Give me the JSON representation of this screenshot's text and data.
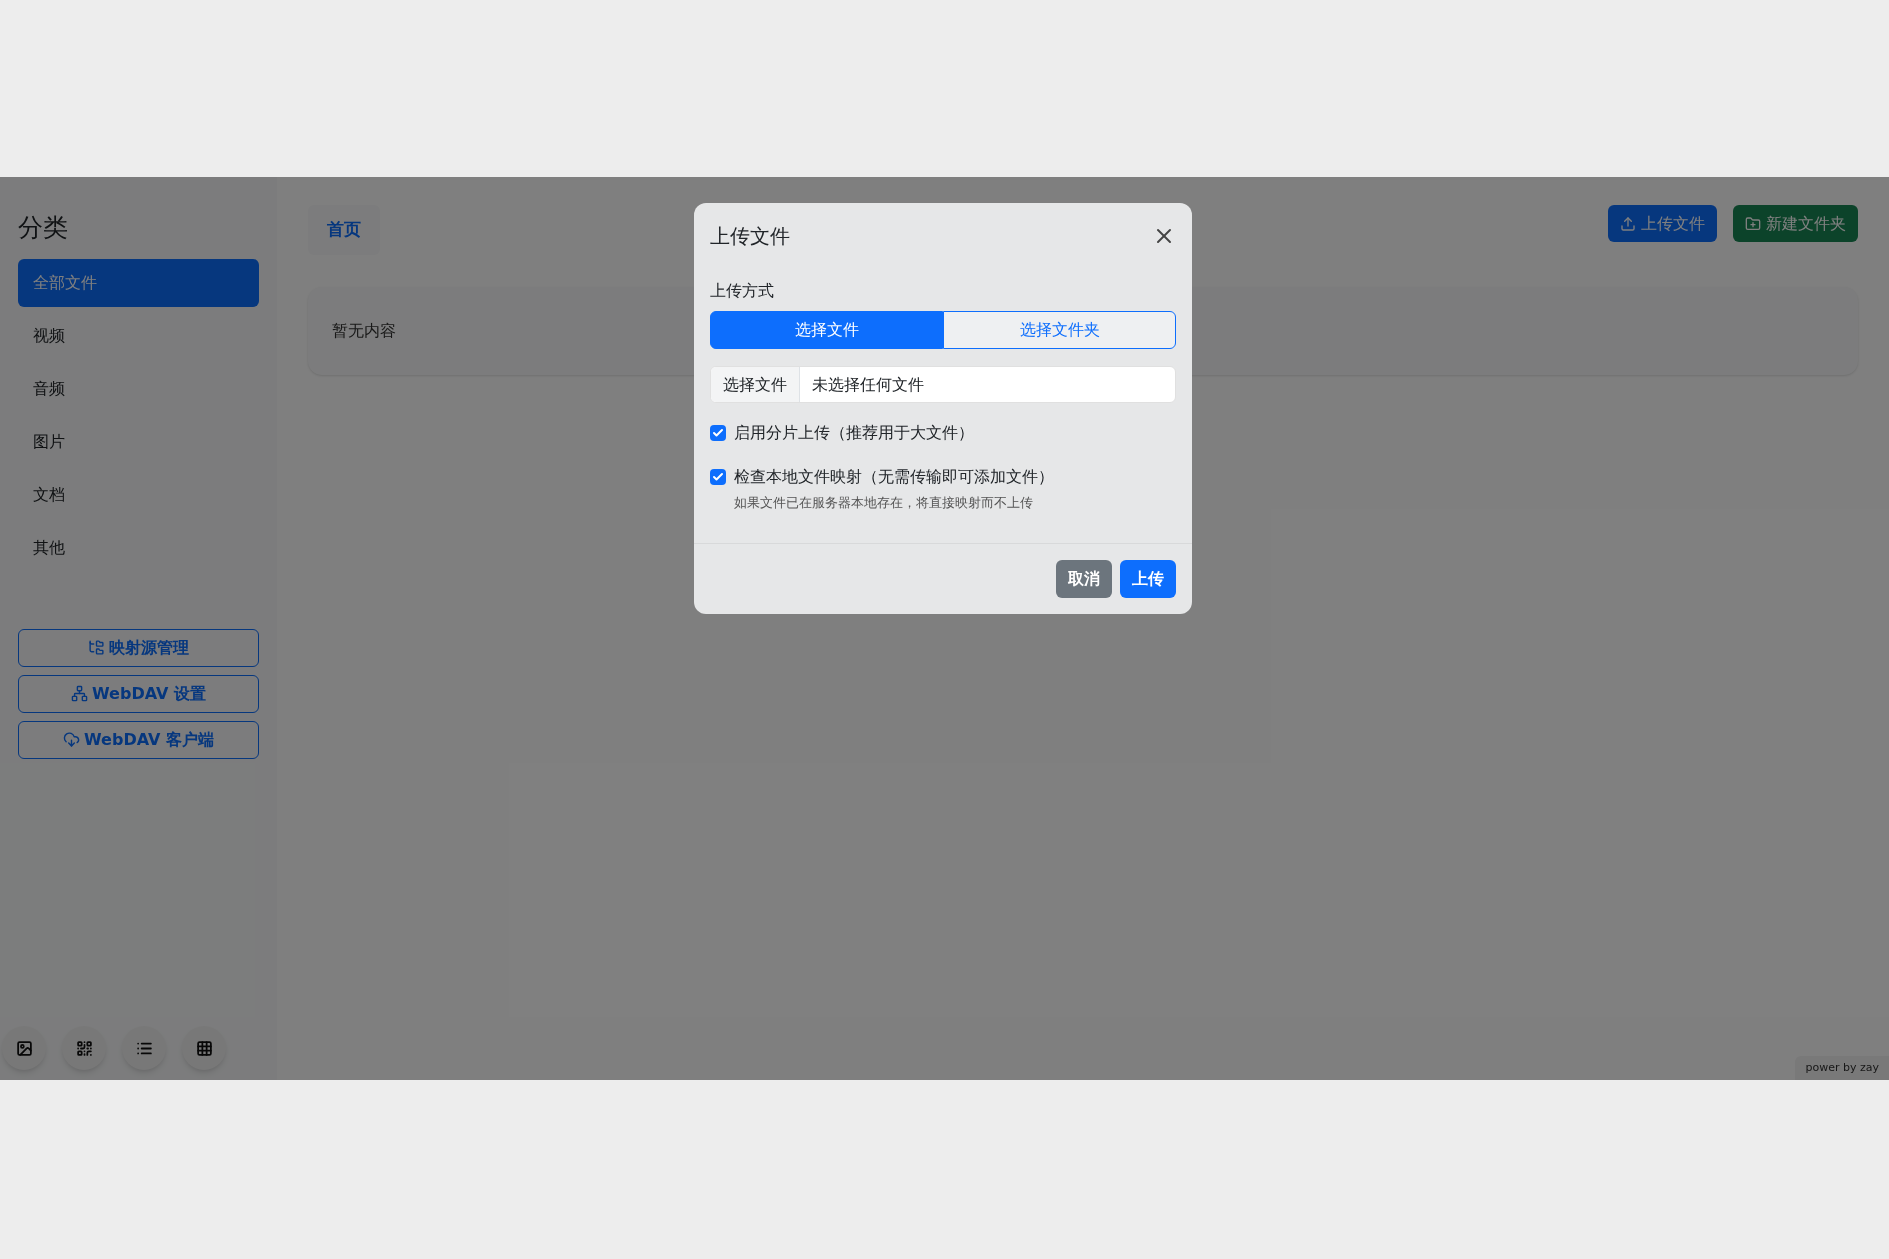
{
  "sidebar": {
    "title": "分类",
    "items": [
      {
        "label": "全部文件",
        "selected": true
      },
      {
        "label": "视频",
        "selected": false
      },
      {
        "label": "音频",
        "selected": false
      },
      {
        "label": "图片",
        "selected": false
      },
      {
        "label": "文档",
        "selected": false
      },
      {
        "label": "其他",
        "selected": false
      }
    ],
    "buttons": [
      {
        "label": "映射源管理",
        "kind": "mapping"
      },
      {
        "label": "WebDAV 设置",
        "kind": "network"
      },
      {
        "label": "WebDAV 客户端",
        "kind": "cloud"
      }
    ],
    "view_buttons": [
      {
        "kind": "image"
      },
      {
        "kind": "qr"
      },
      {
        "kind": "list"
      },
      {
        "kind": "table"
      }
    ]
  },
  "breadcrumb": [
    "首页"
  ],
  "toolbar": [
    {
      "label": "上传文件",
      "kind": "upload"
    },
    {
      "label": "新建文件夹",
      "kind": "folder"
    }
  ],
  "empty_text": "暂无内容",
  "footer": "power by zay",
  "dialog": {
    "title": "上传文件",
    "mode_label": "上传方式",
    "modes": [
      {
        "label": "选择文件",
        "selected": true
      },
      {
        "label": "选择文件夹",
        "selected": false
      }
    ],
    "file_button": "选择文件",
    "file_status": "未选择任何文件",
    "options": [
      {
        "label": "启用分片上传（推荐用于大文件）",
        "checked": true
      },
      {
        "label": "检查本地文件映射（无需传输即可添加文件）",
        "checked": true,
        "hint": "如果文件已在服务器本地存在，将直接映射而不上传"
      }
    ],
    "buttons": [
      {
        "label": "取消",
        "kind": "secondary"
      },
      {
        "label": "上传",
        "kind": "primary"
      }
    ]
  }
}
